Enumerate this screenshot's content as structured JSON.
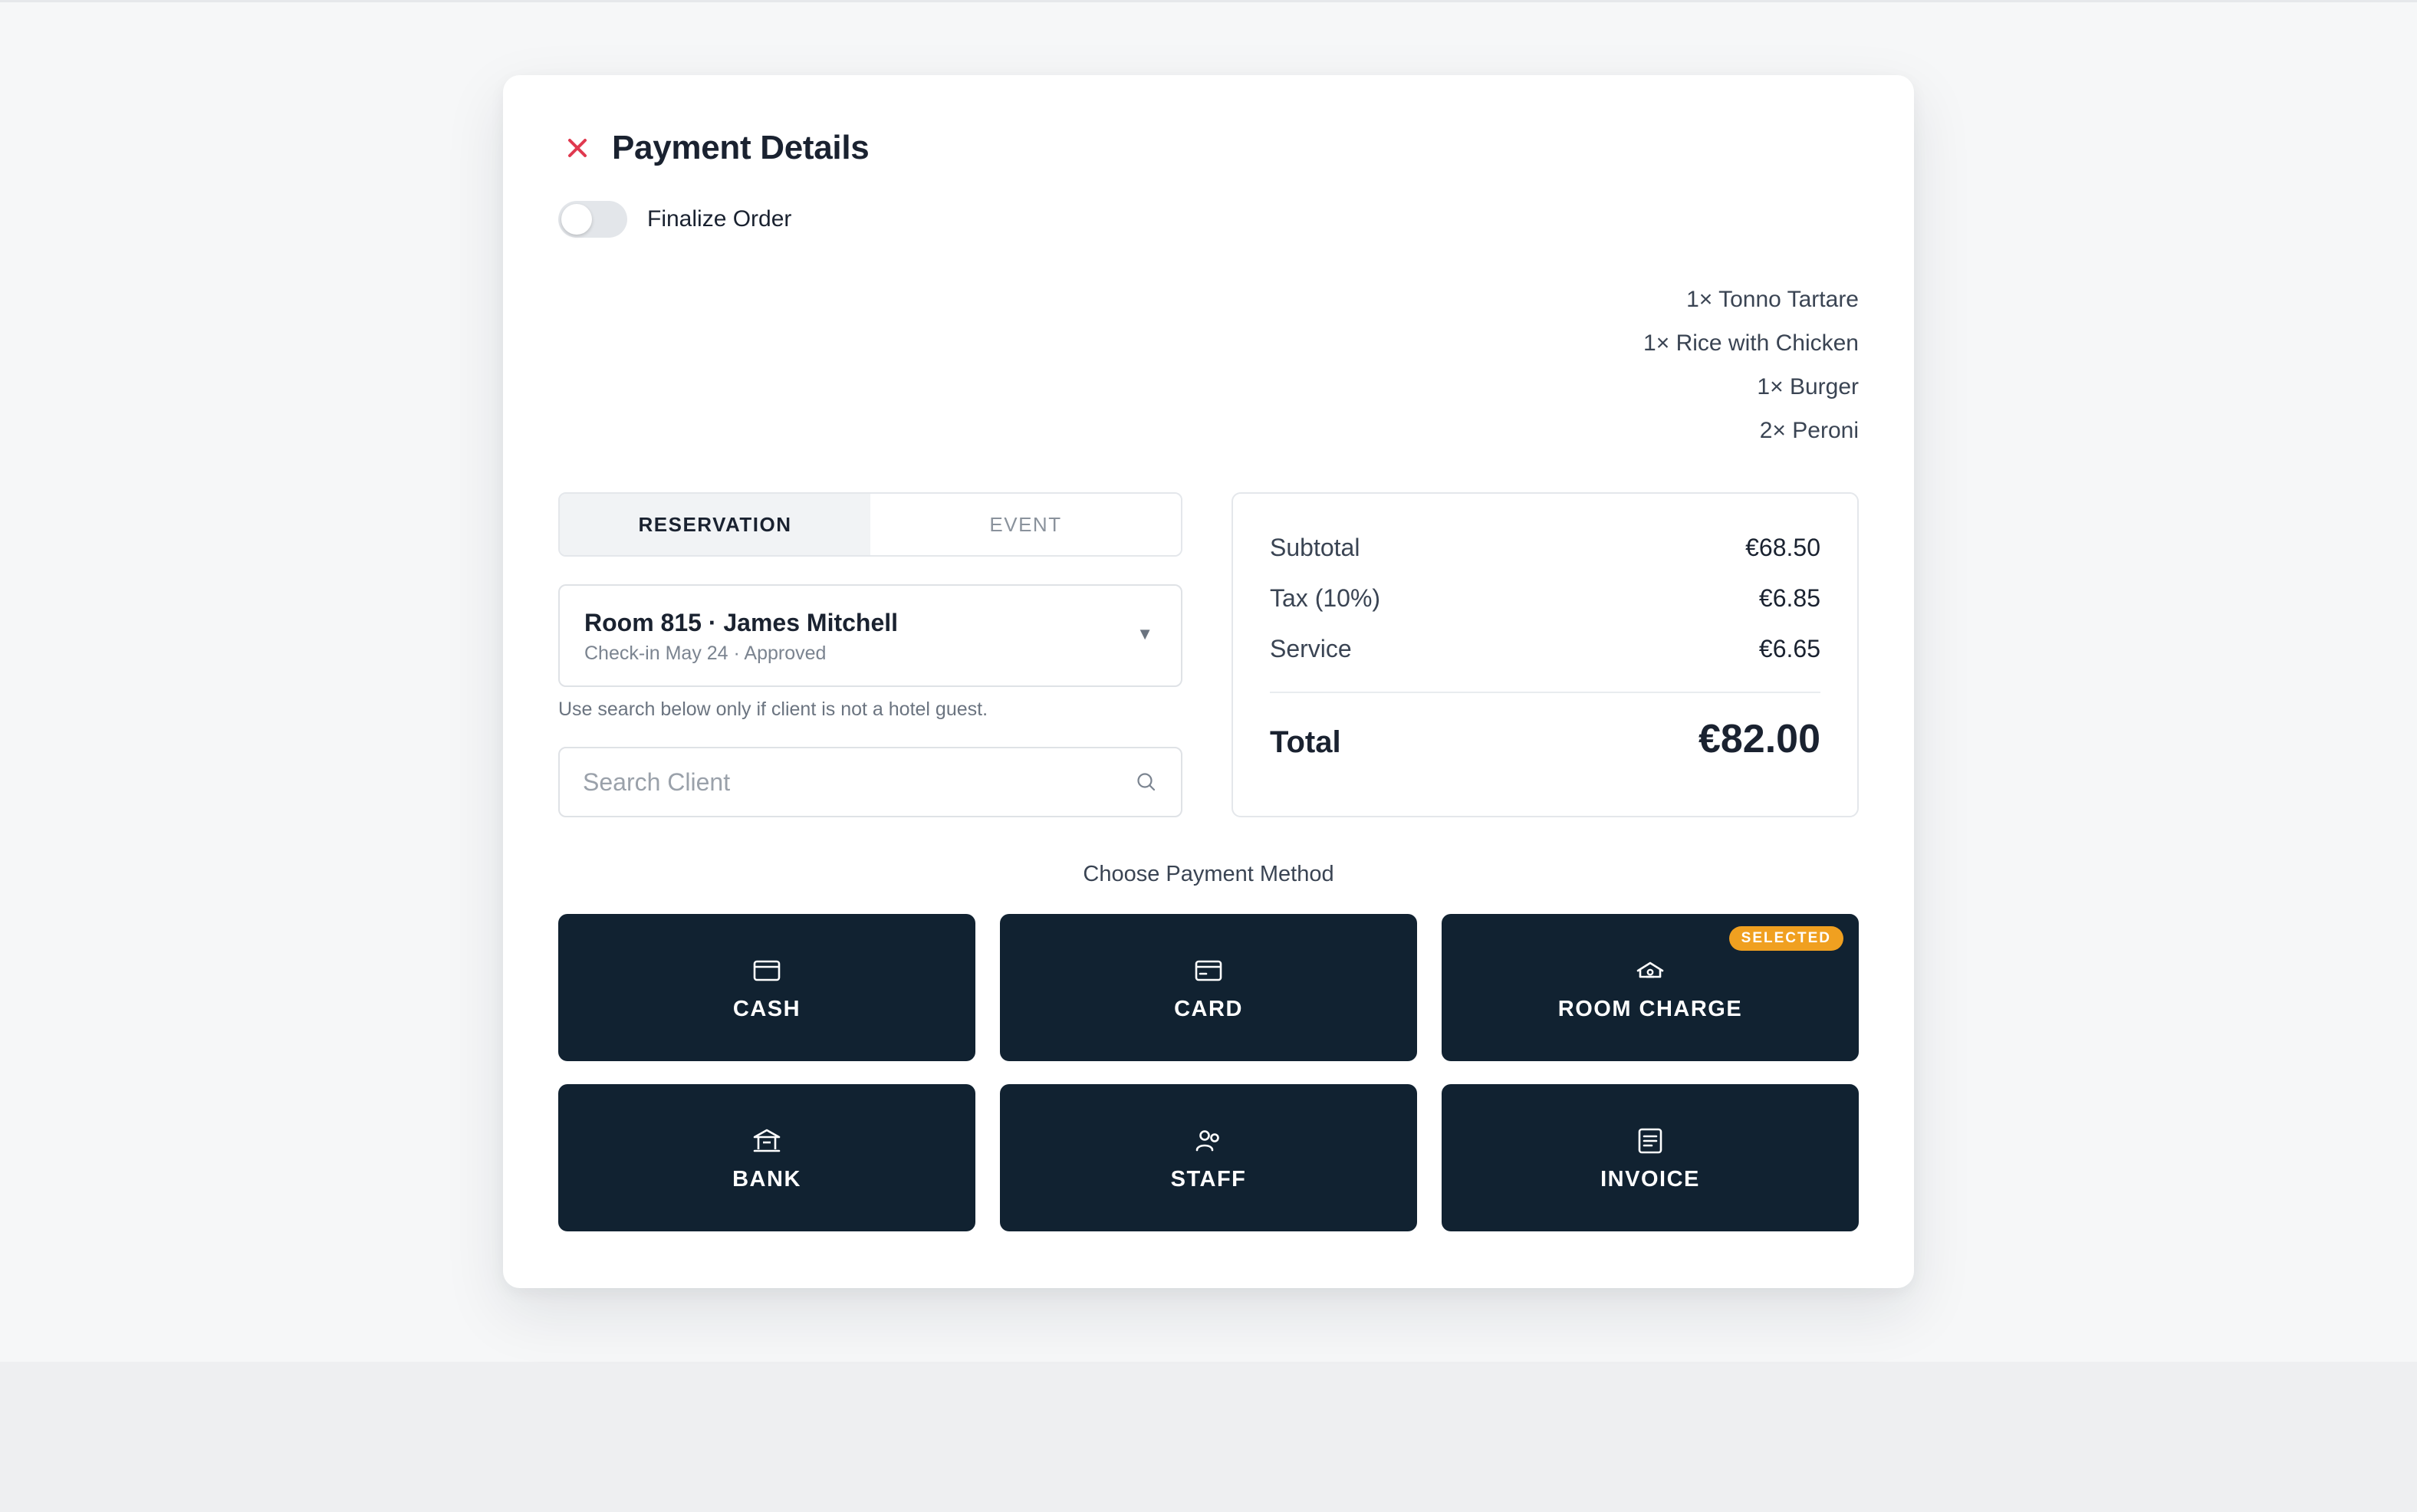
{
  "modal": {
    "title": "Payment Details",
    "finalize_label": "Finalize Order"
  },
  "order_items": [
    "1× Tonno Tartare",
    "1× Rice with Chicken",
    "1× Burger",
    "2× Peroni"
  ],
  "tabs": [
    {
      "label": "RESERVATION",
      "active": true
    },
    {
      "label": "EVENT",
      "active": false
    }
  ],
  "guest": {
    "name": "Room 815 · James Mitchell",
    "meta": "Check-in May 24 · Approved"
  },
  "hint": "Use search below only if client is not a hotel guest.",
  "search": {
    "placeholder": "Search Client",
    "value": ""
  },
  "summary": {
    "subtotal_label": "Subtotal",
    "subtotal_value": "€68.50",
    "tax_label": "Tax (10%)",
    "tax_value": "€6.85",
    "service_label": "Service",
    "service_value": "€6.65",
    "total_label": "Total",
    "total_value": "€82.00"
  },
  "payment": {
    "title": "Choose Payment Method",
    "methods": [
      {
        "label": "CASH",
        "icon": "wallet-icon"
      },
      {
        "label": "CARD",
        "icon": "credit-card-icon"
      },
      {
        "label": "ROOM CHARGE",
        "icon": "hotel-icon",
        "badge": "SELECTED"
      },
      {
        "label": "BANK",
        "icon": "bank-icon"
      },
      {
        "label": "STAFF",
        "icon": "staff-icon"
      },
      {
        "label": "INVOICE",
        "icon": "invoice-icon"
      }
    ]
  },
  "colors": {
    "close_accent": "#e0394f",
    "button_bg": "#112231",
    "badge_bg": "#f0a020"
  }
}
